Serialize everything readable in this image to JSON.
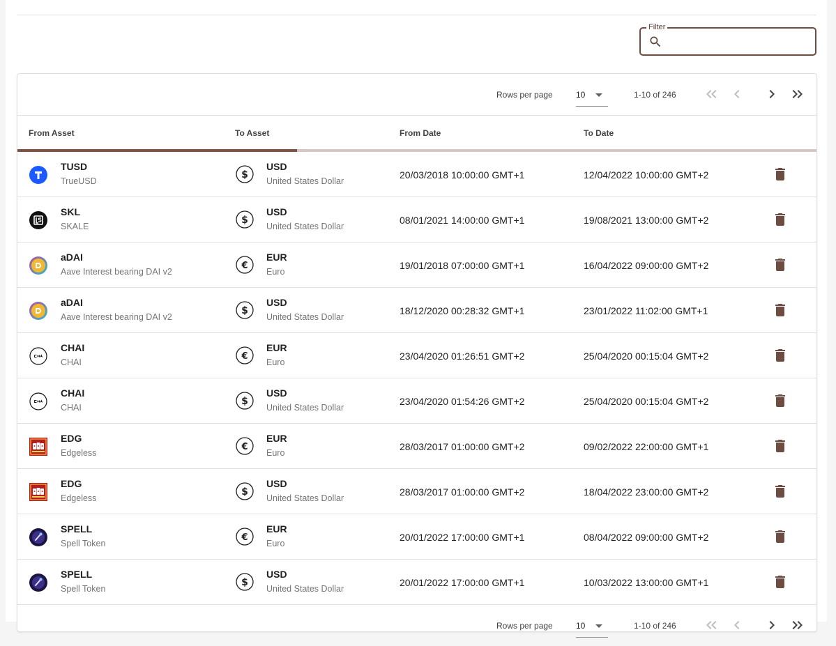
{
  "filter": {
    "label": "Filter",
    "value": "",
    "icon": "search-icon"
  },
  "paginator": {
    "rows_per_page_label": "Rows per page",
    "rows_per_page": "10",
    "range": "1-10 of 246",
    "loading_progress_percent": 35
  },
  "table": {
    "columns": [
      "From Asset",
      "To Asset",
      "From Date",
      "To Date"
    ],
    "rows": [
      {
        "from_symbol": "TUSD",
        "from_name": "TrueUSD",
        "from_icon": "tusd",
        "to_symbol": "USD",
        "to_name": "United States Dollar",
        "to_icon": "dollar-icon",
        "from_date": "20/03/2018 10:00:00 GMT+1",
        "to_date": "12/04/2022 10:00:00 GMT+2"
      },
      {
        "from_symbol": "SKL",
        "from_name": "SKALE",
        "from_icon": "skl",
        "to_symbol": "USD",
        "to_name": "United States Dollar",
        "to_icon": "dollar-icon",
        "from_date": "08/01/2021 14:00:00 GMT+1",
        "to_date": "19/08/2021 13:00:00 GMT+2"
      },
      {
        "from_symbol": "aDAI",
        "from_name": "Aave Interest bearing DAI v2",
        "from_icon": "adai",
        "to_symbol": "EUR",
        "to_name": "Euro",
        "to_icon": "euro-icon",
        "from_date": "19/01/2018 07:00:00 GMT+1",
        "to_date": "16/04/2022 09:00:00 GMT+2"
      },
      {
        "from_symbol": "aDAI",
        "from_name": "Aave Interest bearing DAI v2",
        "from_icon": "adai",
        "to_symbol": "USD",
        "to_name": "United States Dollar",
        "to_icon": "dollar-icon",
        "from_date": "18/12/2020 00:28:32 GMT+1",
        "to_date": "23/01/2022 11:02:00 GMT+1"
      },
      {
        "from_symbol": "CHAI",
        "from_name": "CHAI",
        "from_icon": "chai",
        "to_symbol": "EUR",
        "to_name": "Euro",
        "to_icon": "euro-icon",
        "from_date": "23/04/2020 01:26:51 GMT+2",
        "to_date": "25/04/2020 00:15:04 GMT+2"
      },
      {
        "from_symbol": "CHAI",
        "from_name": "CHAI",
        "from_icon": "chai",
        "to_symbol": "USD",
        "to_name": "United States Dollar",
        "to_icon": "dollar-icon",
        "from_date": "23/04/2020 01:54:26 GMT+2",
        "to_date": "25/04/2020 00:15:04 GMT+2"
      },
      {
        "from_symbol": "EDG",
        "from_name": "Edgeless",
        "from_icon": "edg",
        "to_symbol": "EUR",
        "to_name": "Euro",
        "to_icon": "euro-icon",
        "from_date": "28/03/2017 01:00:00 GMT+2",
        "to_date": "09/02/2022 22:00:00 GMT+1"
      },
      {
        "from_symbol": "EDG",
        "from_name": "Edgeless",
        "from_icon": "edg",
        "to_symbol": "USD",
        "to_name": "United States Dollar",
        "to_icon": "dollar-icon",
        "from_date": "28/03/2017 01:00:00 GMT+2",
        "to_date": "18/04/2022 23:00:00 GMT+2"
      },
      {
        "from_symbol": "SPELL",
        "from_name": "Spell Token",
        "from_icon": "spell",
        "to_symbol": "EUR",
        "to_name": "Euro",
        "to_icon": "euro-icon",
        "from_date": "20/01/2022 17:00:00 GMT+1",
        "to_date": "08/04/2022 09:00:00 GMT+2"
      },
      {
        "from_symbol": "SPELL",
        "from_name": "Spell Token",
        "from_icon": "spell",
        "to_symbol": "USD",
        "to_name": "United States Dollar",
        "to_icon": "dollar-icon",
        "from_date": "20/01/2022 17:00:00 GMT+1",
        "to_date": "10/03/2022 13:00:00 GMT+1"
      }
    ],
    "delete_icon": "trash-icon"
  },
  "colors": {
    "accent": "#795548",
    "progress_track": "#d7c6c2",
    "delete": "#6d4c41"
  }
}
